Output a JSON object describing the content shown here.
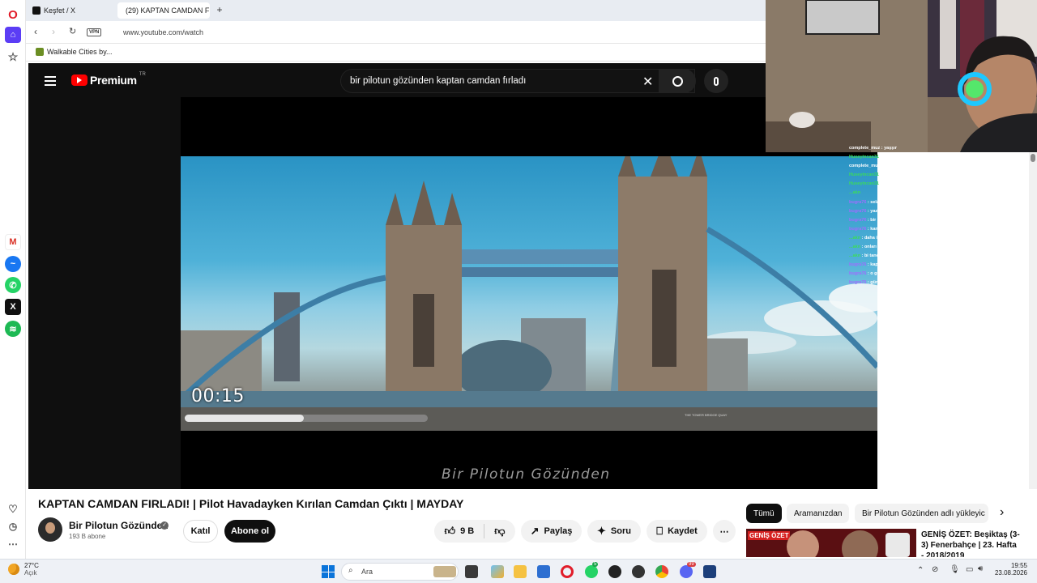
{
  "browser": {
    "tabs": [
      {
        "label": "Keşfet / X"
      },
      {
        "label": "(29) KAPTAN CAMDAN FI..."
      }
    ],
    "new_tab": "+",
    "vpn_badge": "VPN",
    "url": "www.youtube.com/watch",
    "bookmark": "Walkable Cities by..."
  },
  "youtube": {
    "brand": "Premium",
    "region": "TR",
    "search_value": "bir pilotun gözünden kaptan camdan fırladı",
    "video": {
      "timestamp": "00:15",
      "watermark": "Bir Pilotun Gözünden",
      "sign_text": "THE TOWER BRIDGE QUAY",
      "progress": 0.49
    },
    "title": "KAPTAN CAMDAN FIRLADI! | Pilot Havadayken Kırılan Camdan Çıktı | MAYDAY",
    "channel": {
      "name": "Bir Pilotun Gözünden",
      "subscribers": "193 B abone"
    },
    "buttons": {
      "join": "Katıl",
      "subscribe": "Abone ol",
      "likes": "9 B",
      "share": "Paylaş",
      "ask": "Soru",
      "save": "Kaydet",
      "more": "⋯"
    },
    "chips": [
      "Tümü",
      "Aramanızdan",
      "Bir Pilotun Gözünden adlı yükleyic"
    ],
    "recommendation": {
      "badge": "GENİŞ ÖZET",
      "title_line1": "GENİŞ ÖZET: Beşiktaş (3-",
      "title_line2": "3) Fenerbahçe | 23. Hafta",
      "title_line3": "- 2018/2019"
    }
  },
  "chat": [
    {
      "user": "complete_muz",
      "msg": "yaşşır",
      "color": "#ffffff"
    },
    {
      "user": "Huseyincan31",
      "msg": "becaklan iyiymiş abi",
      "color": "#3cdc5a"
    },
    {
      "user": "complete_muz",
      "msg": "yaşdır",
      "color": "#ffffff"
    },
    {
      "user": "Huseyincan31",
      "msg": "Abi bu arada harbili diyorum yalopikian",
      "color": "#3cdc5a"
    },
    {
      "user": "Huseyincan31",
      "msg": "abi ağlama bendeağlarımbak",
      "color": "#3cdc5a"
    },
    {
      "user": "...akn",
      "msg": "",
      "color": "#3cdc5a"
    },
    {
      "user": "bugra76",
      "msg": "selamınaleykum",
      "color": "#a06cff"
    },
    {
      "user": "bugra76",
      "msg": "yazarsın bana",
      "color": "#a06cff"
    },
    {
      "user": "bugra76",
      "msg": "bir pilotun gözünden",
      "color": "#a06cff"
    },
    {
      "user": "bugra76",
      "msg": "kanalın ismi",
      "color": "#a06cff"
    },
    {
      "user": "...akn",
      "msg": "daha iyi",
      "color": "#3cdc5a"
    },
    {
      "user": "...akn",
      "msg": "onları silebiliyormusun ?",
      "color": "#3cdc5a"
    },
    {
      "user": "...akn",
      "msg": "bi tane deneme amaclı almıştım",
      "color": "#3cdc5a"
    },
    {
      "user": "bugra76",
      "msg": "kaptan camdan fırladı var",
      "color": "#a06cff"
    },
    {
      "user": "bugra76",
      "msg": "o güzel",
      "color": "#a06cff"
    },
    {
      "user": "bugra76",
      "msg": "gümüşoylar aramaya başladı",
      "color": "#a06cff"
    }
  ],
  "taskbar": {
    "weather_temp": "27°C",
    "weather_desc": "Açık",
    "search_placeholder": "Ara",
    "whatsapp_badge": "5",
    "discord_badge": "99",
    "time": "19:55",
    "date": "23.08.2026"
  },
  "colors": {
    "yt_red": "#ff0000",
    "yt_dark": "#0f0f0f",
    "opera_red": "#e11d2a"
  }
}
